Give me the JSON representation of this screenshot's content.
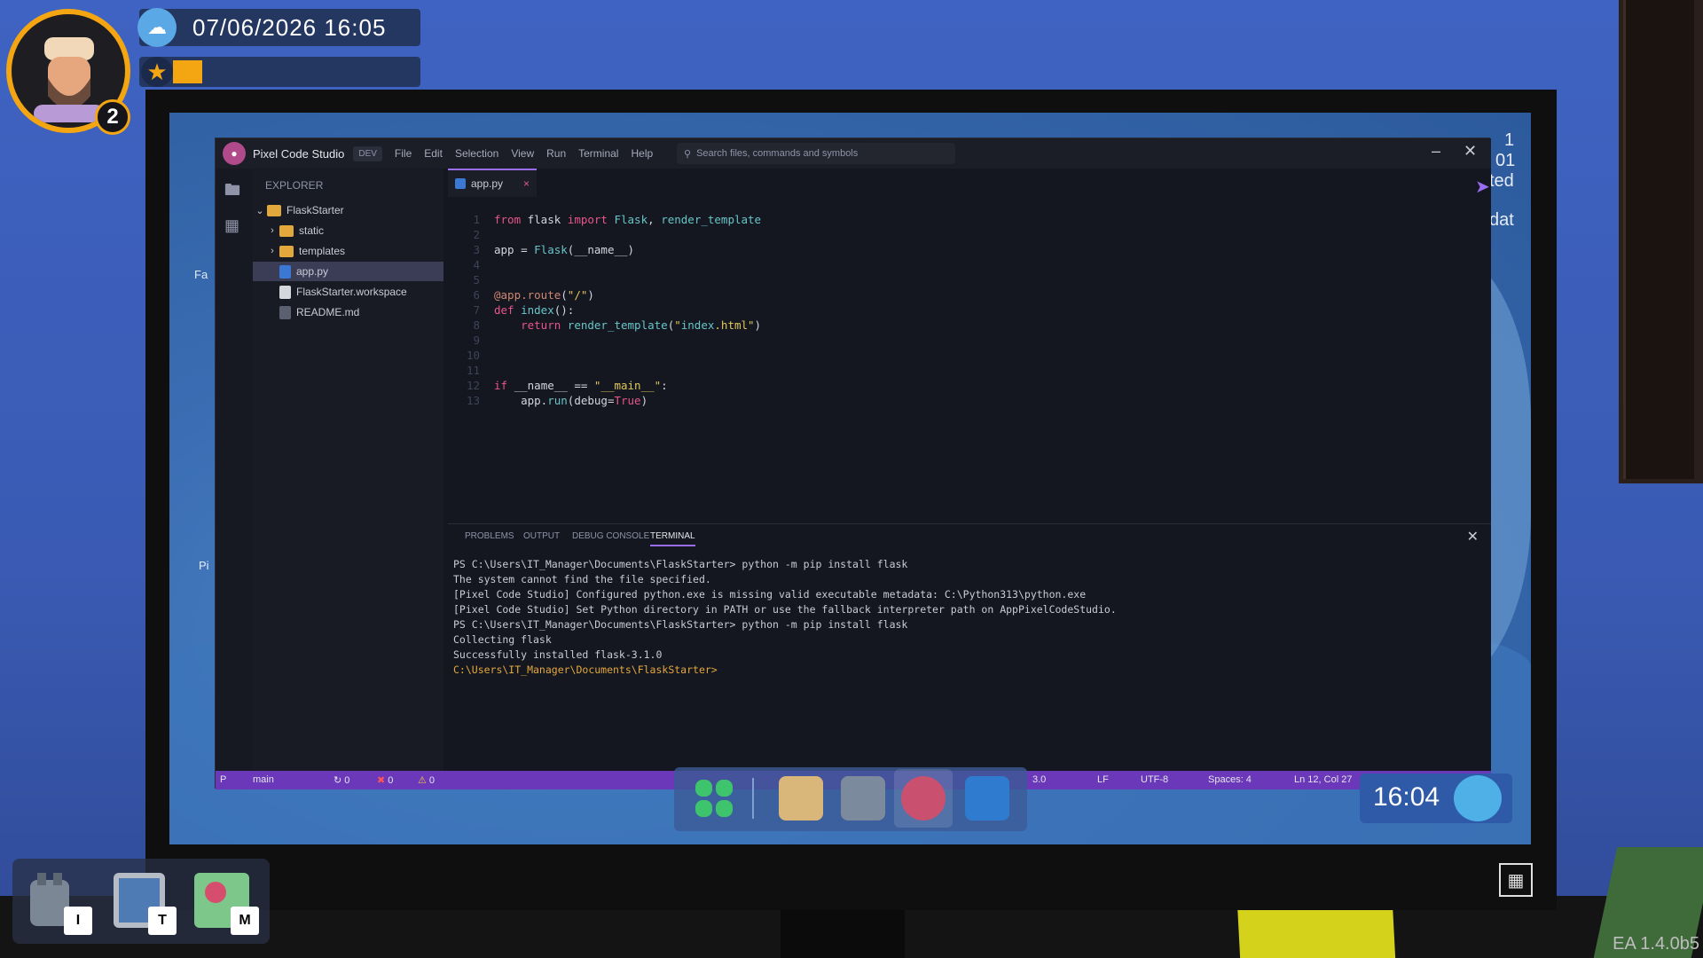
{
  "hud": {
    "datetime": "07/06/2026 16:05",
    "level": "2",
    "xp_progress": 0.12
  },
  "inventory": [
    {
      "name": "backpack",
      "key": "I"
    },
    {
      "name": "tablet",
      "key": "T"
    },
    {
      "name": "map",
      "key": "M"
    }
  ],
  "version": "EA 1.4.0b5",
  "ide": {
    "app_name": "Pixel Code Studio",
    "badge": "DEV",
    "menu": [
      "File",
      "Edit",
      "Selection",
      "View",
      "Run",
      "Terminal",
      "Help"
    ],
    "search_placeholder": "Search files, commands and symbols",
    "explorer_title": "EXPLORER",
    "tree": [
      {
        "label": "FlaskStarter",
        "type": "folder",
        "expanded": true
      },
      {
        "label": "static",
        "type": "folder"
      },
      {
        "label": "templates",
        "type": "folder"
      },
      {
        "label": "app.py",
        "type": "py",
        "selected": true
      },
      {
        "label": "FlaskStarter.workspace",
        "type": "ws"
      },
      {
        "label": "README.md",
        "type": "md"
      }
    ],
    "tab_label": "app.py",
    "code_lines": [
      "from flask import Flask, render_template",
      "",
      "app = Flask(__name__)",
      "",
      "",
      "@app.route(\"/\")",
      "def index():",
      "    return render_template(\"index.html\")",
      "",
      "",
      "",
      "if __name__ == \"__main__\":",
      "    app.run(debug=True)"
    ],
    "panel_tabs": [
      "PROBLEMS",
      "OUTPUT",
      "DEBUG CONSOLE",
      "TERMINAL"
    ],
    "terminal": [
      "PS C:\\Users\\IT_Manager\\Documents\\FlaskStarter> python -m pip install flask",
      "The system cannot find the file specified.",
      "[Pixel Code Studio] Configured python.exe is missing valid executable metadata: C:\\Python313\\python.exe",
      "[Pixel Code Studio] Set Python directory in PATH or use the fallback interpreter path on AppPixelCodeStudio.",
      "PS C:\\Users\\IT_Manager\\Documents\\FlaskStarter> python -m pip install flask",
      "Collecting flask",
      "Successfully installed flask-3.1.0",
      "C:\\Users\\IT_Manager\\Documents\\FlaskStarter>"
    ],
    "status": {
      "branch_icon": "P",
      "branch": "main",
      "sync": "0",
      "errors": "0",
      "warnings": "0",
      "python": "3.0",
      "eol": "LF",
      "encoding": "UTF-8",
      "spaces": "Spaces: 4",
      "position": "Ln 12, Col 27"
    }
  },
  "behind_text": {
    "fa": "Fa",
    "pi": "Pi",
    "r1": "1",
    "r2": "01",
    "r3": "ted",
    "r4": "dat"
  },
  "clock": "16:04"
}
